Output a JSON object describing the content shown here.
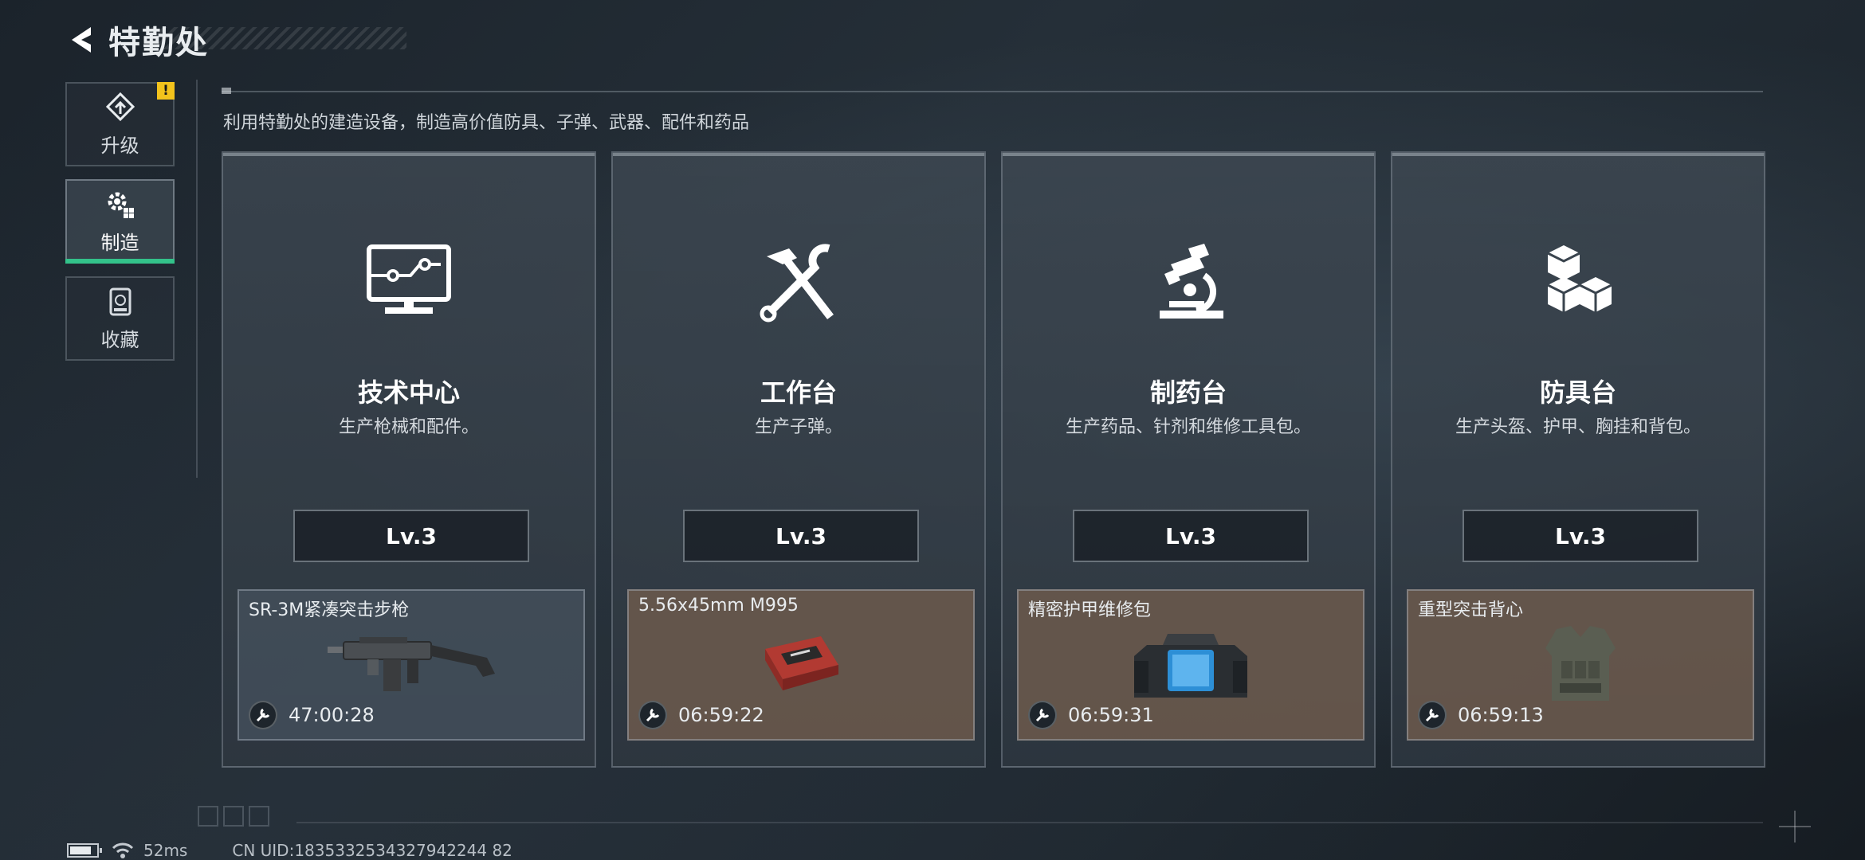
{
  "header": {
    "title": "特勤处",
    "back_icon": "back-arrow-icon"
  },
  "sidebar": {
    "items": [
      {
        "label": "升级",
        "icon": "upgrade-icon",
        "badge": "!",
        "active": false
      },
      {
        "label": "制造",
        "icon": "gear-craft-icon",
        "active": true
      },
      {
        "label": "收藏",
        "icon": "collection-icon",
        "active": false
      }
    ]
  },
  "subtitle": "利用特勤处的建造设备，制造高价值防具、子弹、武器、配件和药品",
  "stations": [
    {
      "name": "技术中心",
      "desc": "生产枪械和配件。",
      "icon": "monitor-circuit-icon",
      "level": "Lv.3",
      "product": {
        "name": "SR-3M紧凑突击步枪",
        "timer": "47:00:28",
        "image": "rifle-image",
        "rarity_color": "#46525e"
      }
    },
    {
      "name": "工作台",
      "desc": "生产子弹。",
      "icon": "hammer-wrench-icon",
      "level": "Lv.3",
      "product": {
        "name": "5.56x45mm M995",
        "timer": "06:59:22",
        "image": "ammo-box-image",
        "rarity_color": "#705c4e"
      }
    },
    {
      "name": "制药台",
      "desc": "生产药品、针剂和维修工具包。",
      "icon": "microscope-icon",
      "level": "Lv.3",
      "product": {
        "name": "精密护甲维修包",
        "timer": "06:59:31",
        "image": "repair-bag-image",
        "rarity_color": "#705c4e"
      }
    },
    {
      "name": "防具台",
      "desc": "生产头盔、护甲、胸挂和背包。",
      "icon": "cubes-icon",
      "level": "Lv.3",
      "product": {
        "name": "重型突击背心",
        "timer": "06:59:13",
        "image": "vest-image",
        "rarity_color": "#705c4e"
      }
    }
  ],
  "status_bar": {
    "ping": "52ms",
    "uid": "CN UID:1835332534327942244 82"
  },
  "colors": {
    "accent_green": "#33c28a",
    "warning_yellow": "#f3c31c"
  }
}
